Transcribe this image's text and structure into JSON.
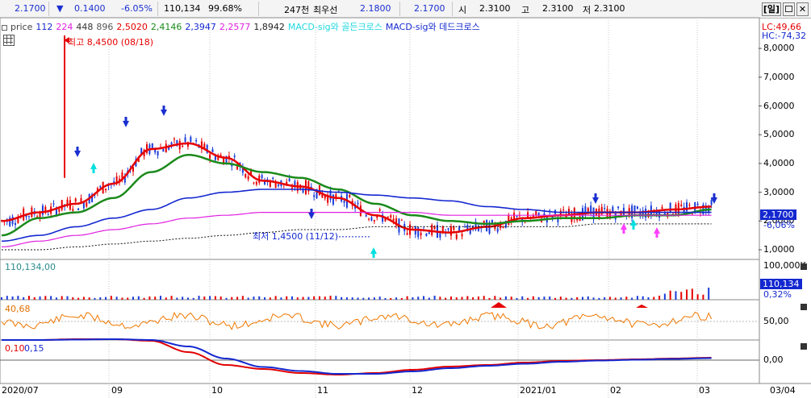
{
  "ticker": {
    "price": "2.1700",
    "change_arrow": "▼",
    "change": "0.1400",
    "change_rate": "-6.05%",
    "volume": "110,134",
    "volume_ratio": "99.68%",
    "trade_value": "247천",
    "best_bid_label": "최우선",
    "ask": "2.1800",
    "bid": "2.1700",
    "open_label": "시",
    "open": "2.3100",
    "high_label": "고",
    "high": "2.3100",
    "low_label": "저",
    "low": "2.3100",
    "period_button": "[일]"
  },
  "legend": {
    "price_label": "price",
    "ma_periods": [
      "112",
      "224",
      "448",
      "896"
    ],
    "ma_values": [
      "2,5020",
      "2,4146",
      "2,3947",
      "2,2577",
      "1,8942"
    ],
    "macd_golden": "MACD-sig와 골든크로스",
    "macd_dead": "MACD-sig와 데드크로스"
  },
  "right_labels": {
    "lc": "LC:49,66",
    "hc": "HC:-74,32",
    "price_ticks": [
      "8,0000",
      "7,0000",
      "6,0000",
      "5,0000",
      "4,0000",
      "3,0000",
      "2,0000",
      "1,0000"
    ],
    "current_price": "2,1700",
    "current_rate": "-6,06%",
    "volume_tick": "100,000K",
    "volume_current": "110,134",
    "volume_pct": "0,32%",
    "osc_tick": "50,00",
    "macd_tick": "0,00"
  },
  "annotations": {
    "high": "최고 8,4500 (08/18)",
    "low": "최저 1,4500 (11/12)",
    "volume_panel": "110,134,00",
    "osc_panel": "40,68",
    "macd_panel": [
      "0,10",
      "0,15"
    ]
  },
  "x_axis": [
    "2020/07",
    "09",
    "10",
    "11",
    "12",
    "2021/01",
    "02",
    "03",
    "03/04"
  ],
  "colors": {
    "ma_red": "#e60000",
    "ma_green": "#1a8a1a",
    "ma_blue": "#1428d0",
    "ma_magenta": "#e020e0",
    "up_candle": "#e60000",
    "down_candle": "#1a3cd8",
    "macd_line": "#e00000",
    "signal_line": "#1428d0",
    "osc_line": "#f07800",
    "golden_arrow": "#00e0e0",
    "dead_arrow": "#1a2fd0",
    "pink_arrow": "#ff40ff"
  },
  "chart_data": {
    "type": "line",
    "title": "",
    "ylim": [
      1.0,
      8.6
    ],
    "x_categories": [
      "2020/07",
      "09",
      "10",
      "11",
      "12",
      "2021/01",
      "02",
      "03",
      "03/04"
    ],
    "series": [
      {
        "values": [
          2.0,
          2.3,
          2.6,
          3.3,
          4.5,
          4.7,
          4.2,
          3.4,
          3.2,
          2.8,
          2.2,
          1.7,
          1.6,
          1.8,
          2.1,
          2.2,
          2.3,
          2.3,
          2.4,
          2.5
        ]
      },
      {
        "values": [
          1.5,
          2.1,
          2.3,
          2.8,
          3.7,
          4.3,
          4.0,
          3.7,
          3.5,
          3.1,
          2.6,
          2.2,
          2.0,
          1.9,
          2.0,
          2.1,
          2.1,
          2.2,
          2.2,
          2.4
        ]
      },
      {
        "values": [
          1.3,
          1.5,
          1.8,
          2.1,
          2.4,
          2.8,
          3.0,
          3.1,
          3.1,
          3.0,
          2.9,
          2.8,
          2.7,
          2.5,
          2.4,
          2.3,
          2.3,
          2.3,
          2.3,
          2.3
        ]
      },
      {
        "values": [
          1.1,
          1.3,
          1.5,
          1.7,
          1.9,
          2.1,
          2.2,
          2.3,
          2.3,
          2.3,
          2.3,
          2.3,
          2.2,
          2.2,
          2.2,
          2.2,
          2.2,
          2.2,
          2.2,
          2.2
        ]
      },
      {
        "values": [
          1.0,
          1.0,
          1.1,
          1.2,
          1.3,
          1.4,
          1.5,
          1.6,
          1.7,
          1.7,
          1.8,
          1.8,
          1.8,
          1.8,
          1.8,
          1.8,
          1.9,
          1.9,
          1.9,
          1.9
        ]
      }
    ]
  }
}
